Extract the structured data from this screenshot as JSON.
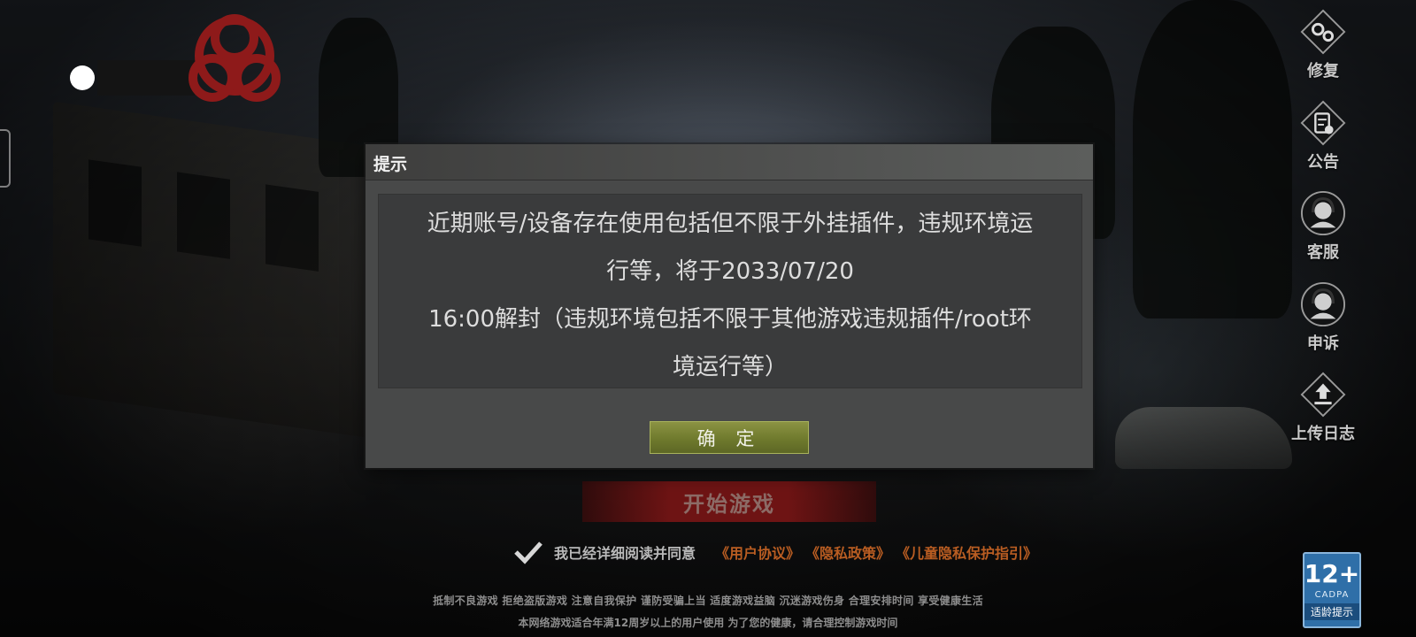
{
  "dialog": {
    "title": "提示",
    "message_lines": [
      "近期账号/设备存在使用包括但不限于外挂插件，违规环境运",
      "行等，将于2033/07/20",
      "16:00解封（违规环境包括不限于其他游戏违规插件/root环",
      "境运行等）"
    ],
    "confirm_label": "确 定"
  },
  "side_menu": [
    {
      "label": "修复",
      "icon": "gears-icon"
    },
    {
      "label": "公告",
      "icon": "notice-clipboard-icon"
    },
    {
      "label": "客服",
      "icon": "headset-person-icon"
    },
    {
      "label": "申诉",
      "icon": "headset-person-icon"
    },
    {
      "label": "上传日志",
      "icon": "upload-icon"
    }
  ],
  "start_button": {
    "label": "开始游戏"
  },
  "agreement": {
    "text": "我已经详细阅读并同意",
    "links": [
      "《用户协议》",
      "《隐私政策》",
      "《儿童隐私保护指引》"
    ],
    "checked": true
  },
  "health_notice": {
    "line1": "抵制不良游戏 拒绝盗版游戏 注意自我保护 谨防受骗上当 适度游戏益脑 沉迷游戏伤身 合理安排时间 享受健康生活",
    "line2": "本网络游戏适合年满12周岁以上的用户使用    为了您的健康，请合理控制游戏时间"
  },
  "age_badge": {
    "rating": "12+",
    "org": "CADPA",
    "tip": "适龄提示"
  },
  "colors": {
    "accent_red": "#6e1414",
    "link_orange": "#b95d22",
    "confirm_green": "#6f7a2d",
    "badge_blue": "#2f6fa8"
  }
}
